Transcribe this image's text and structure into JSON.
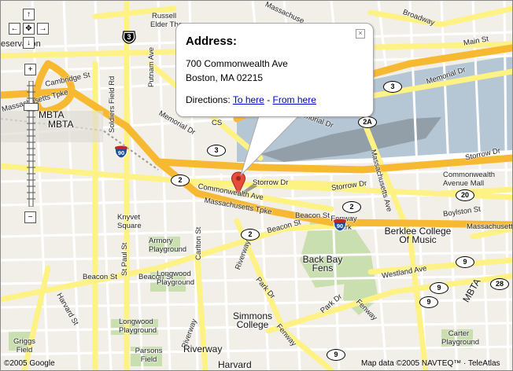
{
  "controls": {
    "pan_up": "↑",
    "pan_down": "↓",
    "pan_left": "←",
    "pan_right": "→",
    "pan_center": "✥",
    "zoom_in": "+",
    "zoom_out": "−"
  },
  "info_window": {
    "title": "Address:",
    "address_line1": "700 Commonwealth Ave",
    "address_line2": "Boston, MA 02215",
    "directions_label": "Directions:",
    "to_here": "To here",
    "separator": "-",
    "from_here": "From here",
    "close": "×"
  },
  "labels": {
    "russell": "Russell",
    "elder_theory": "Elder Theory",
    "reservation": "eservation",
    "cambridge_st": "Cambridge St",
    "massachusetts_tpke_w": "Massachusetts Tpke",
    "mbta_1": "MBTA",
    "mbta_2": "MBTA",
    "soldiers_field_rd": "Soldiers Field Rd",
    "putnam_ave": "Putnam Ave",
    "memorial_dr_1": "Memorial Dr",
    "memorial_dr_2": "Memorial Dr",
    "memorial_dr_3": "Memorial Dr",
    "massachusetts_n": "Massachuse",
    "broadway": "Broadway",
    "main_st": "Main St",
    "storrow_dr_1": "Storrow Dr",
    "storrow_dr_2": "Storrow Dr",
    "storrow_dr_3": "Storrow Dr",
    "commonwealth_ave_mall": "Commonwealth Avenue Mall",
    "commonwealth_ave": "Commonwealth Ave",
    "massachusetts_tpke": "Massachusetts Tpke",
    "massachusetts_ave_e": "Massachusetts",
    "massachusetts_ave_diag": "Massachusetts Ave",
    "boylston_st": "Boylston St",
    "beacon_st_1": "Beacon St",
    "beacon_st_2": "Beacon St",
    "beacon_st_3": "Beacon St",
    "beacon_st_4": "Beacon St",
    "knyvet_square": "Knyvet Square",
    "armory_playground": "Armory Playground",
    "longwood_playground": "Longwood Playground",
    "longwood_playground_2": "Longwood Playground",
    "carlton_st": "Carlton St",
    "st_paul_st": "St Paul St",
    "harvard_st": "Harvard St",
    "fenway_park": "Fenway Park",
    "back_bay_fens": "Back Bay Fens",
    "berklee": "Berklee College Of Music",
    "westland_ave": "Westland Ave",
    "park_dr_1": "Park Dr",
    "park_dr_2": "Park Dr",
    "riverway_1": "Riverway",
    "riverway_2": "Riverway",
    "riverway_3": "Riverway",
    "fenway_1": "Fenway",
    "fenway_2": "Fenway",
    "simmons_college": "Simmons College",
    "mbta_e": "MBTA",
    "carter_playground": "Carter Playground",
    "parsons_field": "Parsons Field",
    "griggs_field": "Griggs Field",
    "harvard_bottom": "Harvard",
    "cs_frag": "CS"
  },
  "shields": {
    "us3_a": "3",
    "us3_b": "3",
    "us3_c": "3",
    "rt2_a": "2",
    "rt2_b": "2",
    "rt2_c": "2",
    "rt2_d": "2",
    "rt2a": "2A",
    "rt20": "20",
    "rt9_a": "9",
    "rt9_b": "9",
    "rt9_c": "9",
    "rt9_d": "9",
    "rt9_e": "9",
    "rt28": "28",
    "i90_a": "90",
    "i90_b": "90"
  },
  "footer": {
    "copyright": "©2005 Google",
    "map_data": "Map data ©2005 NAVTEQ™ · TeleAtlas"
  },
  "colors": {
    "land": "#f2efe9",
    "water": "#b5c6d4",
    "highway": "#f7b932",
    "major_road": "#fdf283",
    "park": "#c9dfb0",
    "marker": "#e64b3c",
    "link": "#0000cc"
  }
}
